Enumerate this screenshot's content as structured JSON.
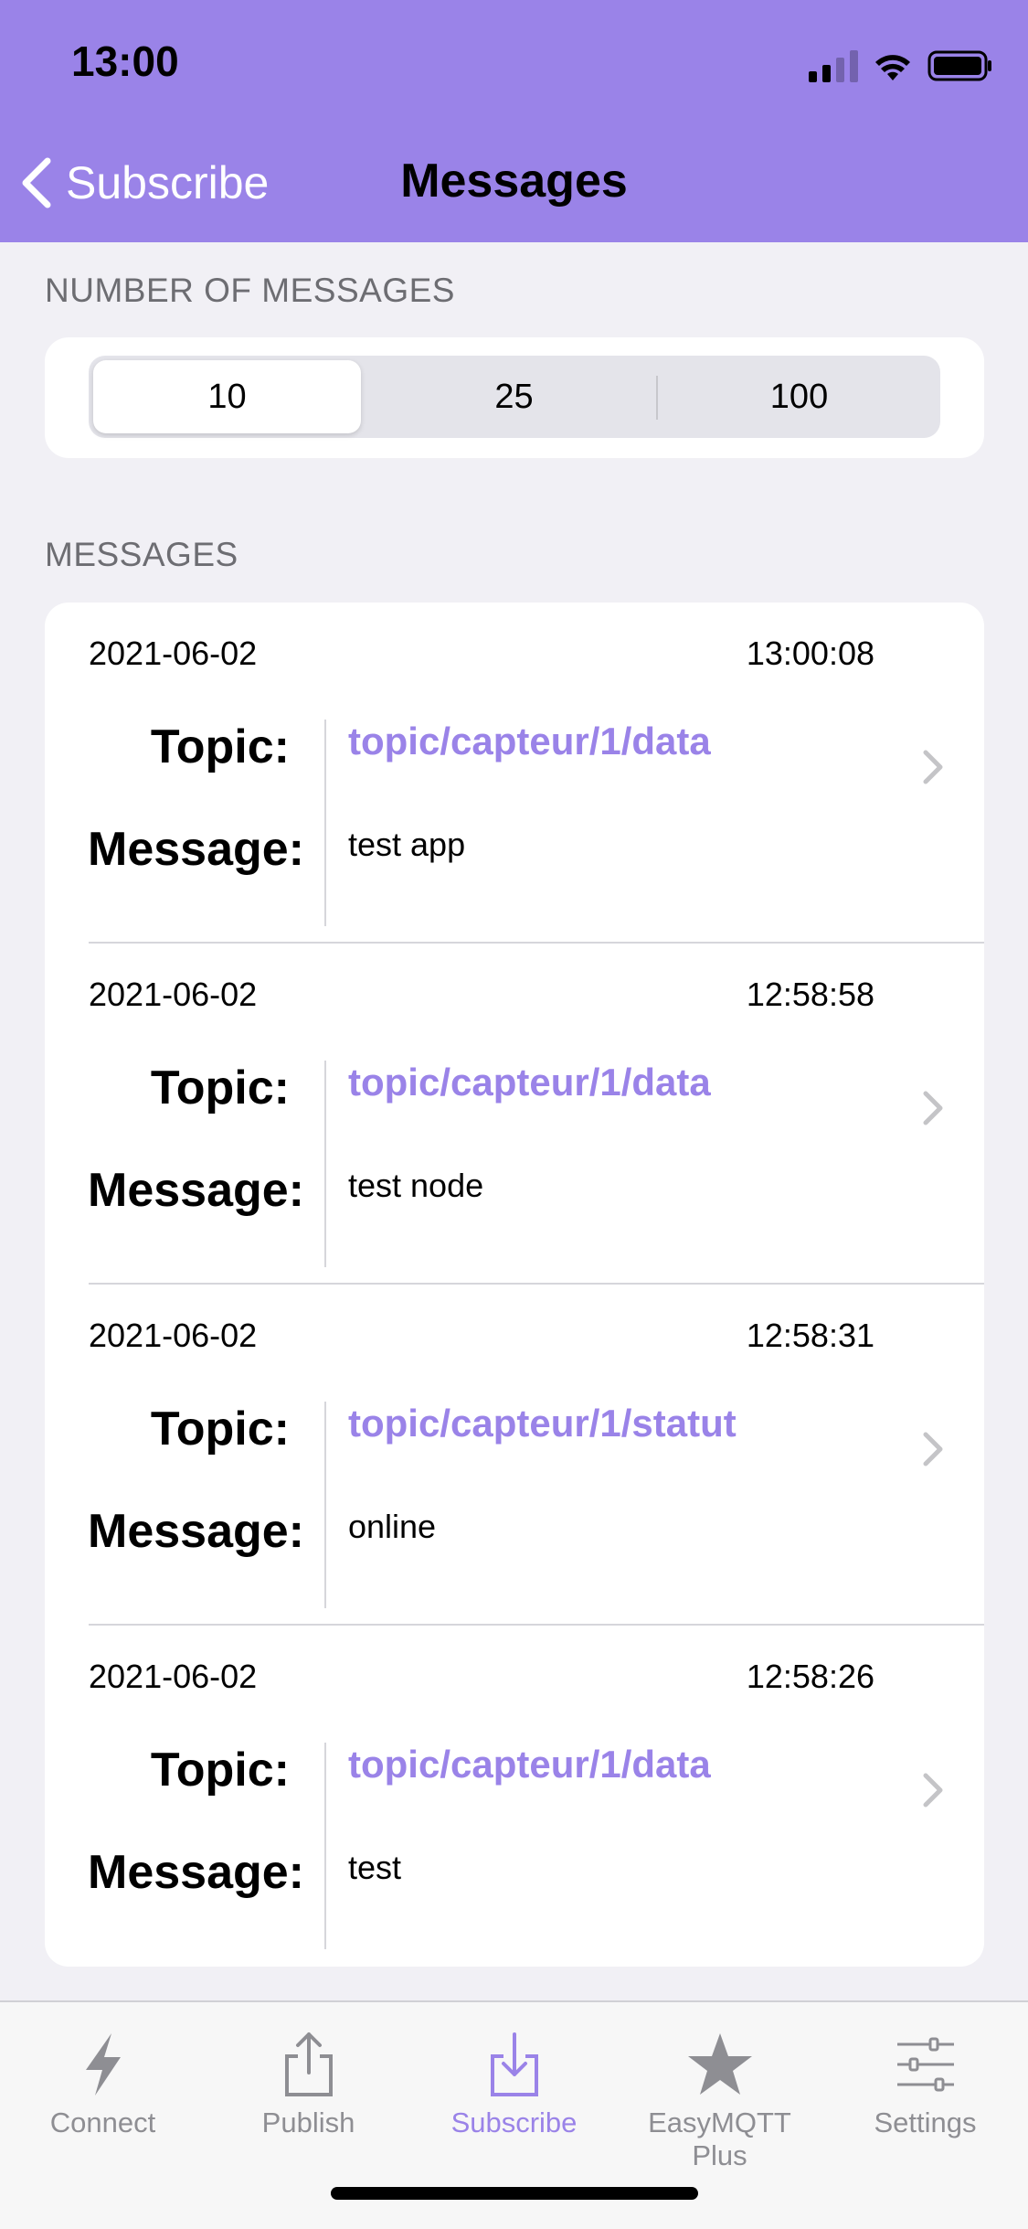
{
  "status_bar": {
    "time": "13:00"
  },
  "nav": {
    "back_label": "Subscribe",
    "title": "Messages"
  },
  "number_section": {
    "label": "NUMBER OF MESSAGES",
    "options": [
      "10",
      "25",
      "100"
    ],
    "selected": "10"
  },
  "messages_section": {
    "label": "MESSAGES",
    "topic_label": "Topic:",
    "message_label": "Message:",
    "items": [
      {
        "date": "2021-06-02",
        "time": "13:00:08",
        "topic": "topic/capteur/1/data",
        "message": "test app"
      },
      {
        "date": "2021-06-02",
        "time": "12:58:58",
        "topic": "topic/capteur/1/data",
        "message": "test node"
      },
      {
        "date": "2021-06-02",
        "time": "12:58:31",
        "topic": "topic/capteur/1/statut",
        "message": "online"
      },
      {
        "date": "2021-06-02",
        "time": "12:58:26",
        "topic": "topic/capteur/1/data",
        "message": "test"
      }
    ]
  },
  "tabbar": {
    "tabs": [
      {
        "label": "Connect",
        "icon": "bolt-icon"
      },
      {
        "label": "Publish",
        "icon": "share-up-icon"
      },
      {
        "label": "Subscribe",
        "icon": "download-tray-icon"
      },
      {
        "label": "EasyMQTT Plus",
        "icon": "star-icon"
      },
      {
        "label": "Settings",
        "icon": "sliders-icon"
      }
    ],
    "active": "Subscribe"
  },
  "colors": {
    "accent": "#9A83E8",
    "background": "#F1F0F5",
    "tab_inactive": "#8E8E93"
  }
}
